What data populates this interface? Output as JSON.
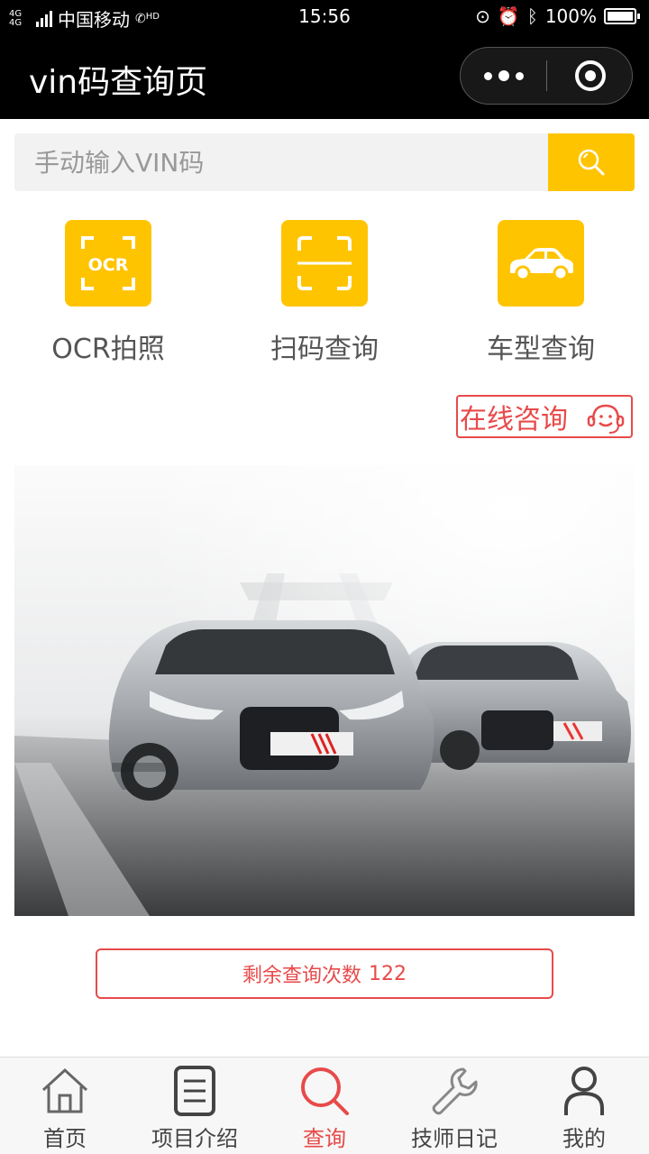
{
  "status_bar": {
    "network": "4G 4G",
    "carrier": "中国移动",
    "hd": "HD",
    "time": "15:56",
    "battery": "100%"
  },
  "nav": {
    "title": "vin码查询页",
    "more_icon": "more-dots-icon",
    "close_icon": "close-target-icon"
  },
  "search": {
    "placeholder": "手动输入VIN码",
    "value": "",
    "icon": "search-icon"
  },
  "features": [
    {
      "label": "OCR拍照",
      "icon": "ocr-icon",
      "icon_text": "OCR"
    },
    {
      "label": "扫码查询",
      "icon": "scan-icon"
    },
    {
      "label": "车型查询",
      "icon": "car-icon"
    }
  ],
  "consult": {
    "label": "在线咨询",
    "icon": "headset-smile-icon"
  },
  "banner": {
    "icon": "car-banner-image"
  },
  "remaining": {
    "label": "剩余查询次数",
    "count": "122"
  },
  "tabs": [
    {
      "label": "首页",
      "icon": "home-icon",
      "active": false
    },
    {
      "label": "项目介绍",
      "icon": "list-icon",
      "active": false
    },
    {
      "label": "查询",
      "icon": "search-icon",
      "active": true
    },
    {
      "label": "技师日记",
      "icon": "wrench-icon",
      "active": false
    },
    {
      "label": "我的",
      "icon": "user-icon",
      "active": false
    }
  ],
  "colors": {
    "accent": "#ffc400",
    "red": "#e84a4a",
    "nav_bg": "#000000"
  }
}
